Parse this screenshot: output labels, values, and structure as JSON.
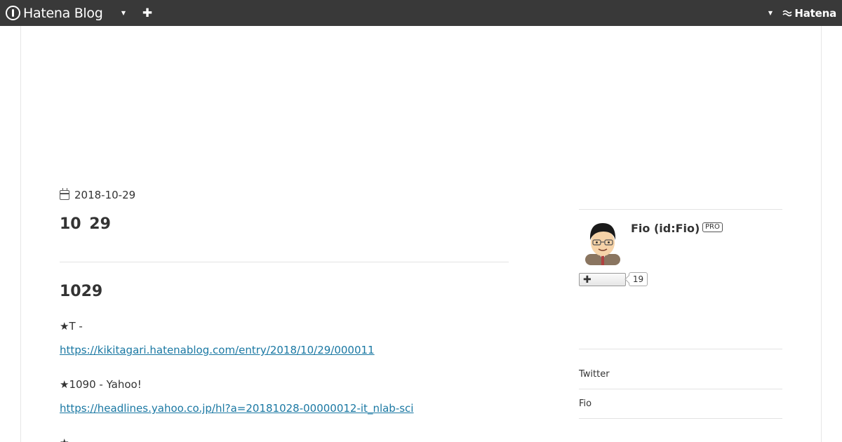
{
  "topbar": {
    "brand": "Hatena Blog",
    "blog_menu_icon": "caret-down-icon",
    "new_post_icon": "plus-icon",
    "user_menu_icon": "caret-down-icon",
    "service_logo": "Hatena",
    "background": "#393939"
  },
  "entry": {
    "date": "2018-10-29",
    "title": "10  29",
    "section_heading": "1029",
    "items": [
      {
        "text": "★T -",
        "url": "https://kikitagari.hatenablog.com/entry/2018/10/29/000011"
      },
      {
        "text": "★1090 - Yahoo!",
        "url": "https://headlines.yahoo.co.jp/hl?a=20181028-00000012-it_nlab-sci"
      }
    ],
    "next_item_text": "★"
  },
  "sidebar": {
    "author_name": "Fio (id:Fio)",
    "pro_badge": "PRO",
    "follow_button_icon": "plus-icon",
    "follower_count": "19",
    "links": [
      "Twitter",
      "Fio"
    ]
  },
  "colors": {
    "link": "#1a78a3",
    "text": "#333333"
  }
}
